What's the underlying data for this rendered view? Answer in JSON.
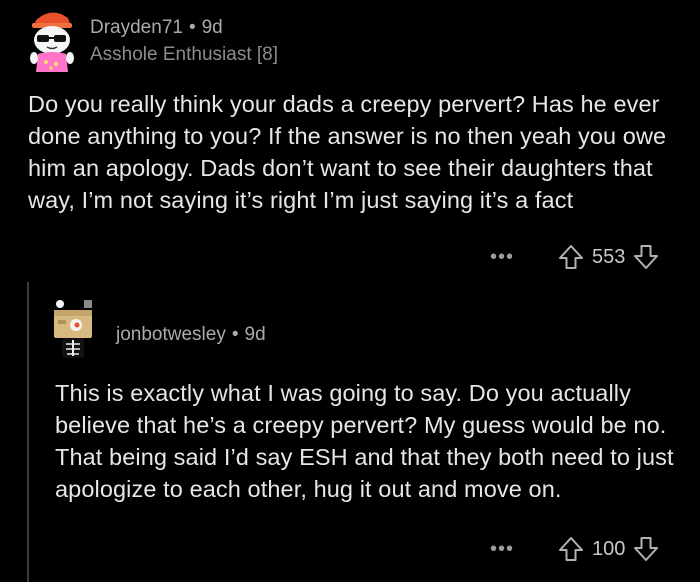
{
  "comments": [
    {
      "username": "Drayden71",
      "separator": "•",
      "age": "9d",
      "flair": "Asshole Enthusiast [8]",
      "body": "Do you really think your dads a creepy pervert? Has he ever done anything to you? If the answer is no then yeah you owe him an apology. Dads don’t want to see their daughters that way, I’m not saying it’s right I’m just saying it’s a fact",
      "more": "•••",
      "score": "553",
      "avatar_icon": "snoo-avatar-sunglasses-icon"
    },
    {
      "username": "jonbotwesley",
      "separator": "•",
      "age": "9d",
      "body": "This is exactly what I was going to say. Do you actually believe that he’s a creepy pervert? My guess would be no. That being said I’d say ESH and that they  both need to just apologize to each other, hug it out  and move on.",
      "more": "•••",
      "score": "100",
      "avatar_icon": "box-head-avatar-icon"
    }
  ],
  "colors": {
    "background": "#000000",
    "text": "#e4e6e7",
    "meta": "#a8aaab",
    "thread_line": "#3a3b3c"
  }
}
